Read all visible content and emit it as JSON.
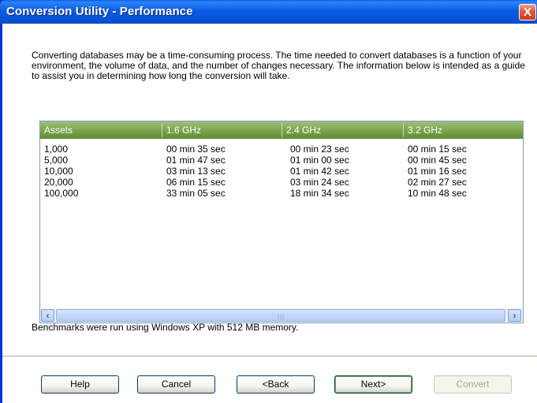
{
  "window": {
    "title": "Conversion Utility - Performance",
    "close_glyph": "X"
  },
  "intro_text": "Converting databases may be a time-consuming process. The time needed to convert databases is a function of your environment, the volume of data, and the number of changes necessary. The information below is intended as a guide to assist you in determining how long the conversion will take.",
  "table": {
    "columns": [
      "Assets",
      "1.6 GHz",
      "2.4 GHz",
      "3.2 GHz"
    ],
    "rows": [
      [
        "1,000",
        "00 min 35 sec",
        "00 min 23 sec",
        "00 min 15 sec"
      ],
      [
        "5,000",
        "01 min 47 sec",
        "01 min 00 sec",
        "00 min 45 sec"
      ],
      [
        "10,000",
        "03 min 13 sec",
        "01 min 42 sec",
        "01 min 16 sec"
      ],
      [
        "20,000",
        "06 min 15 sec",
        "03 min 24 sec",
        "02 min 27 sec"
      ],
      [
        "100,000",
        "33 min 05 sec",
        "18 min 34 sec",
        "10 min 48 sec"
      ]
    ]
  },
  "scrollbar": {
    "left_icon": "arrow-left-icon",
    "right_icon": "arrow-right-icon"
  },
  "benchmark_text": "Benchmarks were run using Windows XP with 512 MB memory.",
  "buttons": {
    "help": "Help",
    "cancel": "Cancel",
    "back": "<Back",
    "next": "Next>",
    "convert": "Convert"
  },
  "colors": {
    "titlebar": "#0753d6",
    "header_green": "#76a047",
    "close_red": "#e05a36"
  }
}
